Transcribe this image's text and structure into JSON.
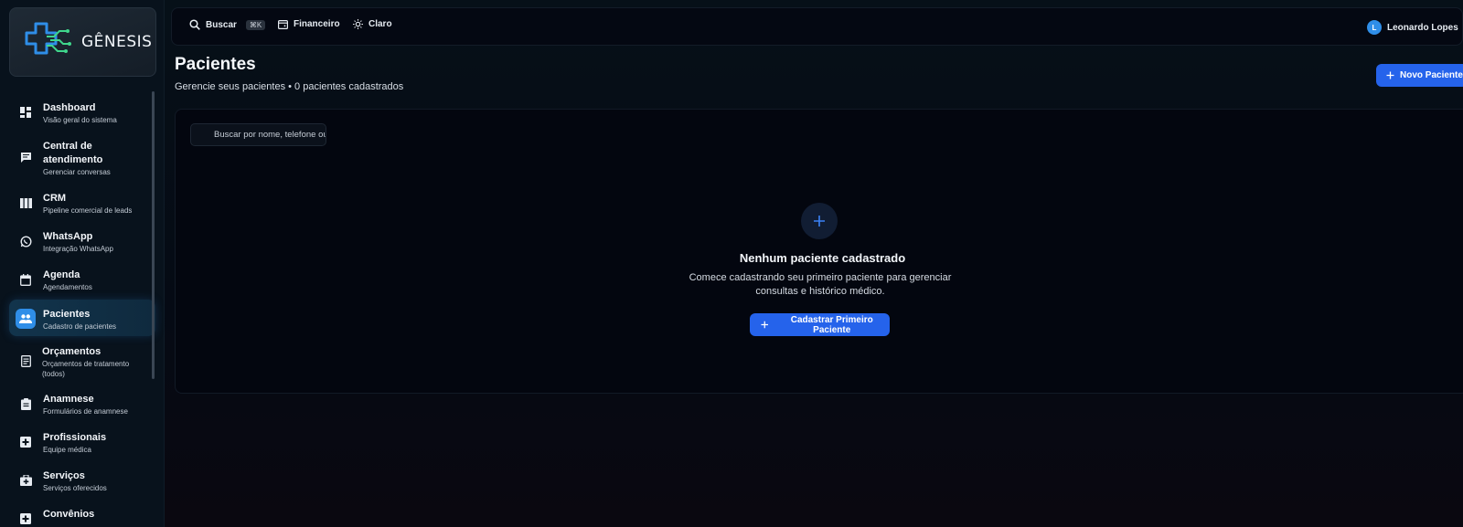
{
  "brand": {
    "name": "GÊNESIS"
  },
  "sidebar": {
    "items": [
      {
        "label": "Dashboard",
        "sub": "Visão geral do sistema",
        "icon": "dashboard-icon"
      },
      {
        "label": "Central de atendimento",
        "sub": "Gerenciar conversas",
        "icon": "chat-icon"
      },
      {
        "label": "CRM",
        "sub": "Pipeline comercial de leads",
        "icon": "kanban-icon"
      },
      {
        "label": "WhatsApp",
        "sub": "Integração WhatsApp",
        "icon": "whatsapp-icon"
      },
      {
        "label": "Agenda",
        "sub": "Agendamentos",
        "icon": "calendar-icon"
      },
      {
        "label": "Pacientes",
        "sub": "Cadastro de pacientes",
        "icon": "users-icon",
        "active": true
      },
      {
        "label": "Orçamentos",
        "sub": "Orçamentos de tratamento (todos)",
        "icon": "receipt-icon"
      },
      {
        "label": "Anamnese",
        "sub": "Formulários de anamnese",
        "icon": "clipboard-icon"
      },
      {
        "label": "Profissionais",
        "sub": "Equipe médica",
        "icon": "medical-cross-icon"
      },
      {
        "label": "Serviços",
        "sub": "Serviços oferecidos",
        "icon": "medical-bag-icon"
      },
      {
        "label": "Convênios",
        "sub": "",
        "icon": "medical-cross-icon"
      }
    ]
  },
  "topbar": {
    "search_label": "Buscar",
    "search_shortcut": "⌘K",
    "finance_label": "Financeiro",
    "theme_label": "Claro",
    "user_name": "Leonardo Lopes",
    "user_initial": "L"
  },
  "page": {
    "title": "Pacientes",
    "subtitle": "Gerencie seus pacientes • 0 pacientes cadastrados",
    "new_button": "Novo Paciente"
  },
  "list": {
    "search_placeholder": "Buscar por nome, telefone ou",
    "empty_title": "Nenhum paciente cadastrado",
    "empty_desc": "Comece cadastrando seu primeiro paciente para gerenciar consultas e histórico médico.",
    "empty_button": "Cadastrar Primeiro Paciente"
  },
  "colors": {
    "accent": "#2563eb",
    "active_icon": "#2f8ee8",
    "logo_green": "#3fd68c",
    "logo_blue": "#2f8ee8"
  }
}
